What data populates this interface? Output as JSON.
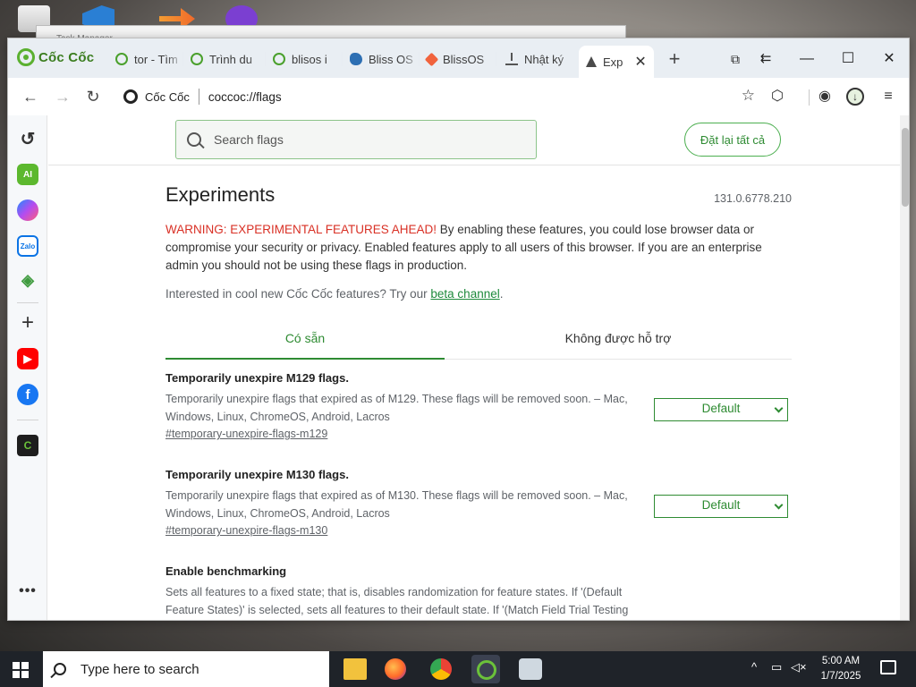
{
  "taskmanager_title": "Task Manager",
  "browser": {
    "brand": "Cốc Cốc",
    "tabs": [
      {
        "label": "tor - Tìm"
      },
      {
        "label": "Trình du"
      },
      {
        "label": "blisos i"
      },
      {
        "label": "Bliss OS"
      },
      {
        "label": "BlissOS"
      },
      {
        "label": "Nhật ký"
      },
      {
        "label": "Exp"
      }
    ],
    "window_controls": {
      "minimize": "—",
      "maximize": "☐",
      "close": "✕"
    }
  },
  "toolbar": {
    "site_name": "Cốc Cốc",
    "url": "coccoc://flags"
  },
  "sidebar": {
    "ai_label": "AI",
    "zalo_label": "Zalo",
    "coccoc_label": "C"
  },
  "header": {
    "search_placeholder": "Search flags",
    "reset_label": "Đặt lại tất cả"
  },
  "content": {
    "title": "Experiments",
    "version": "131.0.6778.210",
    "warning_prefix": "WARNING: EXPERIMENTAL FEATURES AHEAD!",
    "warning_text": " By enabling these features, you could lose browser data or compromise your security or privacy. Enabled features apply to all users of this browser. If you are an enterprise admin you should not be using these flags in production.",
    "interest_text": "Interested in cool new Cốc Cốc features? Try our ",
    "interest_link": "beta channel",
    "interest_end": ".",
    "tabs": [
      {
        "label": "Có sẵn"
      },
      {
        "label": "Không được hỗ trợ"
      }
    ],
    "flags": [
      {
        "title": "Temporarily unexpire M129 flags.",
        "description": "Temporarily unexpire flags that expired as of M129. These flags will be removed soon. – Mac, Windows, Linux, ChromeOS, Android, Lacros",
        "link": "#temporary-unexpire-flags-m129",
        "value": "Default"
      },
      {
        "title": "Temporarily unexpire M130 flags.",
        "description": "Temporarily unexpire flags that expired as of M130. These flags will be removed soon. – Mac, Windows, Linux, ChromeOS, Android, Lacros",
        "link": "#temporary-unexpire-flags-m130",
        "value": "Default"
      },
      {
        "title": "Enable benchmarking",
        "description": "Sets all features to a fixed state; that is, disables randomization for feature states. If '(Default Feature States)' is selected, sets all features to their default state. If '(Match Field Trial Testing",
        "link": "",
        "value": ""
      }
    ]
  },
  "taskbar": {
    "search_placeholder": "Type here to search",
    "time": "5:00 AM",
    "date": "1/7/2025",
    "tray_chevron": "^"
  }
}
